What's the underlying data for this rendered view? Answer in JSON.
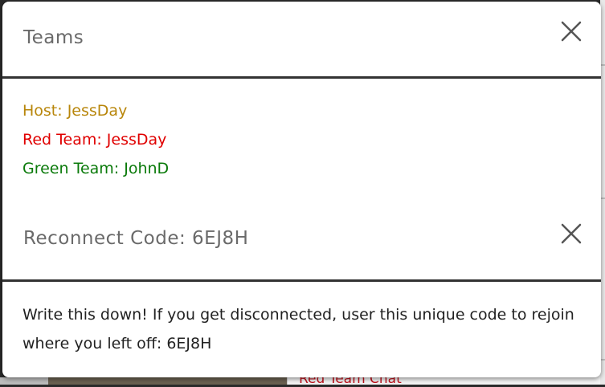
{
  "teams_modal": {
    "title": "Teams",
    "close_icon": "close-icon",
    "host_line": "Host: JessDay",
    "red_team_line": "Red Team: JessDay",
    "green_team_line": "Green Team: JohnD",
    "colors": {
      "host": "#b8860b",
      "red_team": "#e00000",
      "green_team": "#0a7a0a"
    }
  },
  "reconnect_modal": {
    "title": "Reconnect Code: 6EJ8H",
    "close_icon": "close-icon",
    "message": "Write this down! If you get disconnected, user this unique code to rejoin where you left off: 6EJ8H"
  },
  "background": {
    "chat_label": "Red Team Chat"
  }
}
